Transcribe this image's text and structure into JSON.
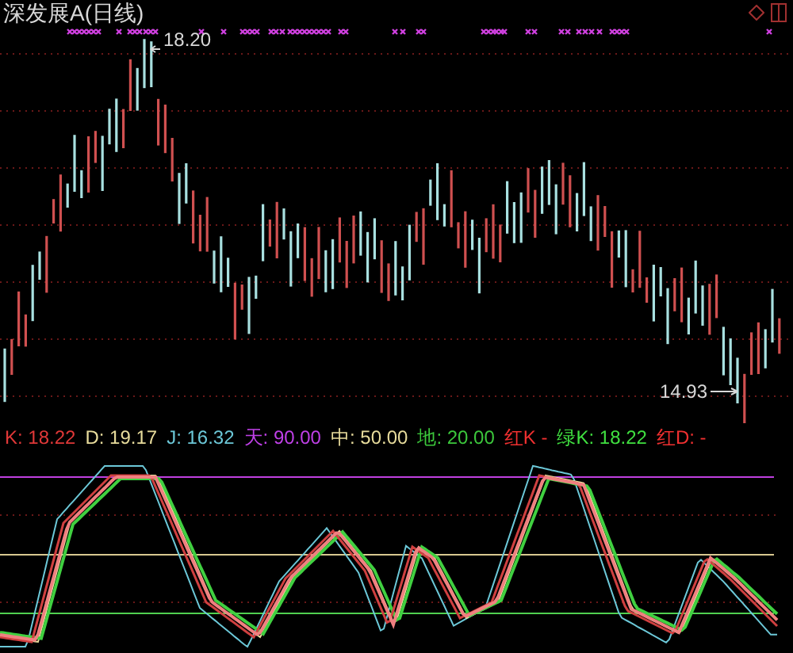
{
  "chart_title": "深发展A(日线)",
  "high_label": "18.20",
  "low_label": "14.93",
  "indicator_legend": [
    {
      "text": "K: 18.22",
      "color": "#e03838"
    },
    {
      "text": "D: 19.17",
      "color": "#e8dc9c"
    },
    {
      "text": "J: 16.32",
      "color": "#6cc8d8"
    },
    {
      "text": "天: 90.00",
      "color": "#c040e8"
    },
    {
      "text": "中: 50.00",
      "color": "#e8dc9c"
    },
    {
      "text": "地: 20.00",
      "color": "#3cc83c"
    },
    {
      "text": "红K -",
      "color": "#f03030"
    },
    {
      "text": "绿K: 18.22",
      "color": "#40e040"
    },
    {
      "text": "红D: -",
      "color": "#f03030"
    }
  ]
}
